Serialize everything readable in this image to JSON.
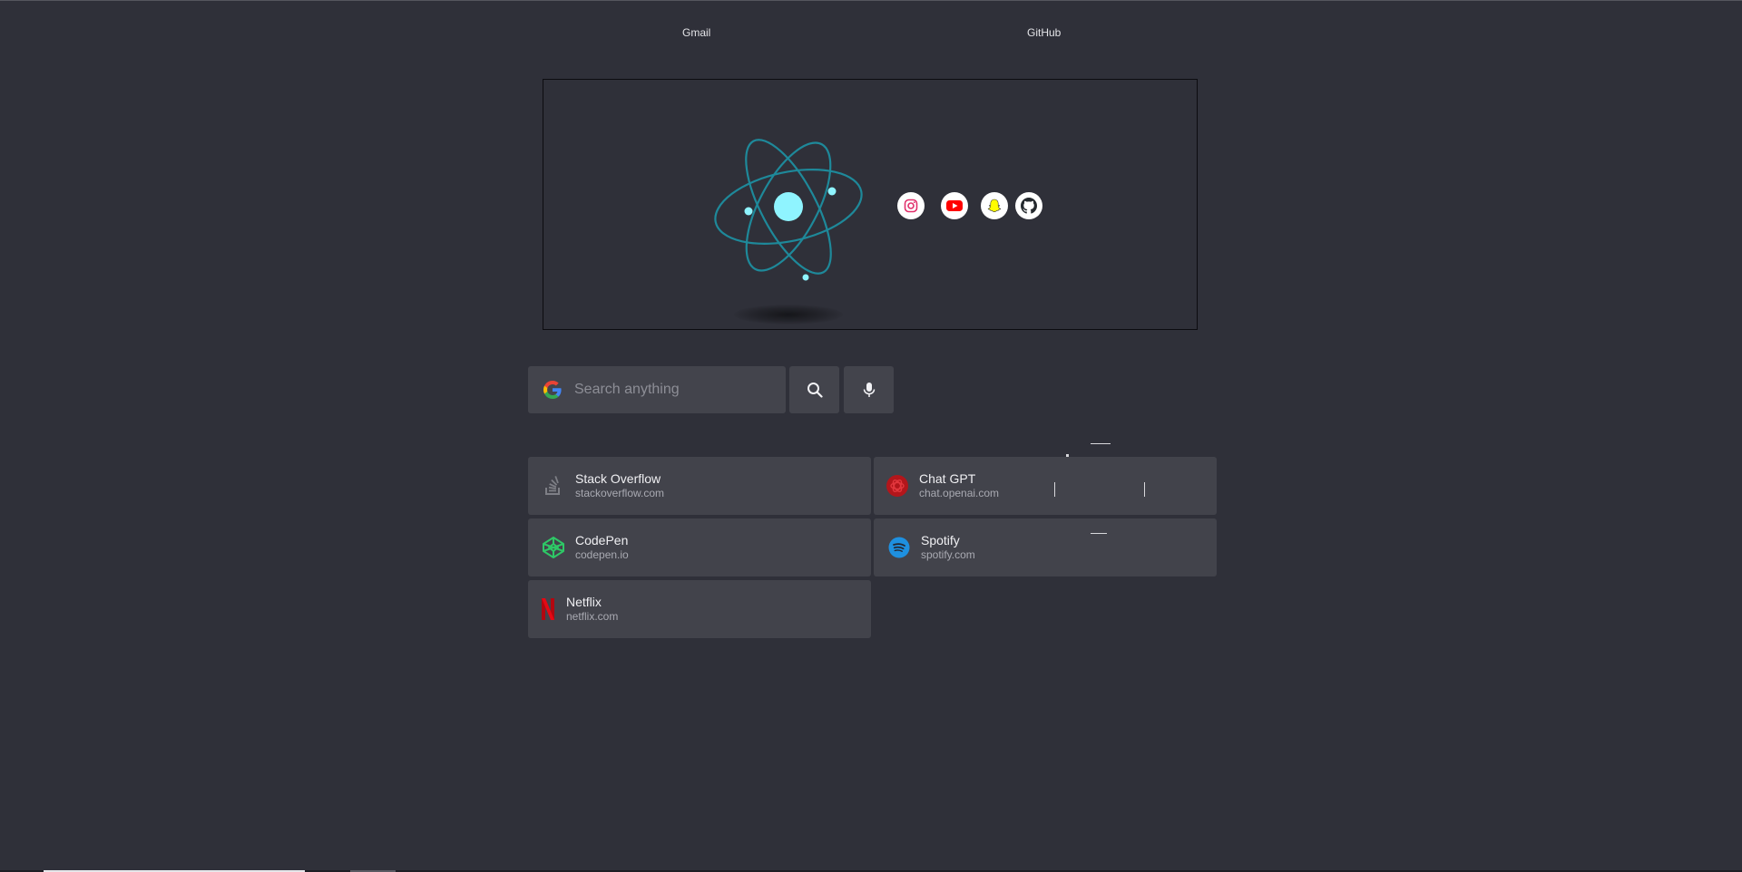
{
  "top_links": {
    "gmail": "Gmail",
    "github": "GitHub"
  },
  "hero": {
    "logo_icon": "atom-icon",
    "socials": [
      {
        "name": "instagram",
        "icon": "instagram-icon",
        "color": "#e1306c"
      },
      {
        "name": "youtube",
        "icon": "youtube-icon",
        "color": "#ff0000"
      },
      {
        "name": "snapchat",
        "icon": "snapchat-icon",
        "color": "#fffc00"
      },
      {
        "name": "github",
        "icon": "github-icon",
        "color": "#24292e"
      }
    ]
  },
  "search": {
    "placeholder": "Search anything",
    "engine_icon": "google-icon",
    "search_icon": "search-icon",
    "mic_icon": "microphone-icon"
  },
  "shortcuts": [
    {
      "name": "Stack Overflow",
      "url": "stackoverflow.com",
      "icon": "stackoverflow-icon"
    },
    {
      "name": "Chat GPT",
      "url": "chat.openai.com",
      "icon": "openai-icon"
    },
    {
      "name": "CodePen",
      "url": "codepen.io",
      "icon": "codepen-icon"
    },
    {
      "name": "Spotify",
      "url": "spotify.com",
      "icon": "spotify-icon"
    },
    {
      "name": "Netflix",
      "url": "netflix.com",
      "icon": "netflix-icon"
    }
  ],
  "colors": {
    "background": "#2f3039",
    "card": "#42434b",
    "accent": "#7ff0ff"
  }
}
